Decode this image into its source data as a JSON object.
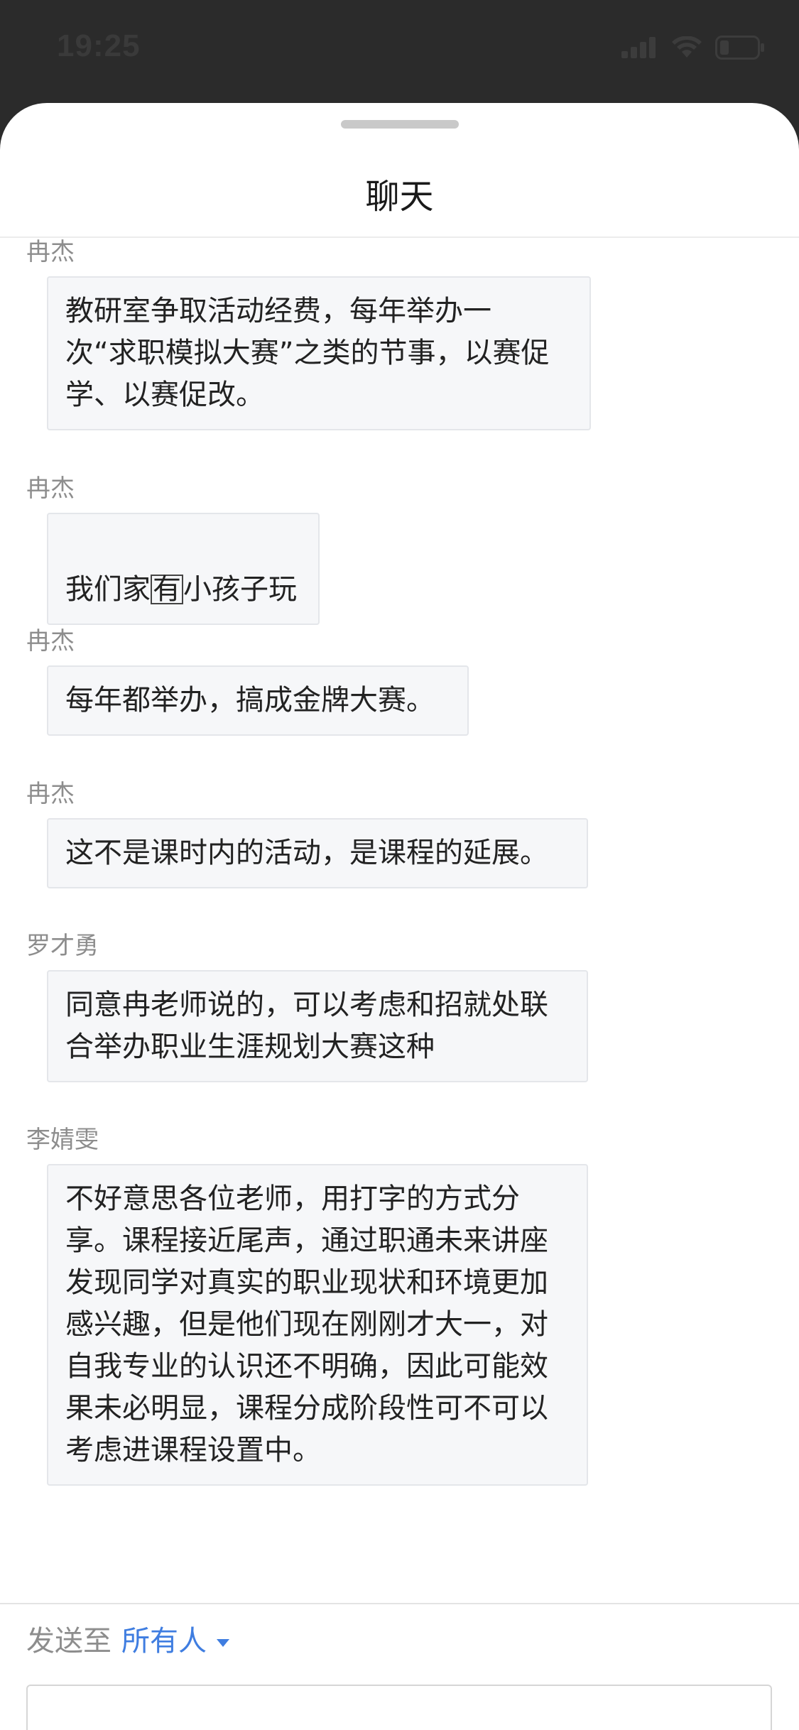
{
  "status_bar": {
    "time": "19:25",
    "signal_icon": "cellular-signal-icon",
    "wifi_icon": "wifi-icon",
    "battery_icon": "battery-low-icon"
  },
  "sheet": {
    "title": "聊天"
  },
  "messages": [
    {
      "sender": "冉杰",
      "text": "教研室争取活动经费，每年举办一\n次“求职模拟大赛”之类的节事，以赛促\n学、以赛促改。"
    },
    {
      "sender": "冉杰",
      "text_before": "我们家",
      "text_boxed": "有",
      "text_after": "小孩子玩"
    },
    {
      "sender": "冉杰",
      "text": "每年都举办，搞成金牌大赛。"
    },
    {
      "sender": "冉杰",
      "text": "这不是课时内的活动，是课程的延展。"
    },
    {
      "sender": "罗才勇",
      "text": "同意冉老师说的，可以考虑和招就处联\n合举办职业生涯规划大赛这种"
    },
    {
      "sender": "李婧雯",
      "text": "不好意思各位老师，用打字的方式分\n享。课程接近尾声，通过职通未来讲座\n发现同学对真实的职业现状和环境更加\n感兴趣，但是他们现在刚刚才大一，对\n自我专业的认识还不明确，因此可能效\n果未必明显，课程分成阶段性可不可以\n考虑进课程设置中。"
    }
  ],
  "composer": {
    "send_to_label": "发送至",
    "recipient": "所有人",
    "input_value": "",
    "input_placeholder": ""
  },
  "colors": {
    "accent": "#3f7de0",
    "bubble_bg": "#f6f7f9",
    "sender_gray": "#8d8d8d",
    "status_bar_bg": "#2b2b2b"
  }
}
